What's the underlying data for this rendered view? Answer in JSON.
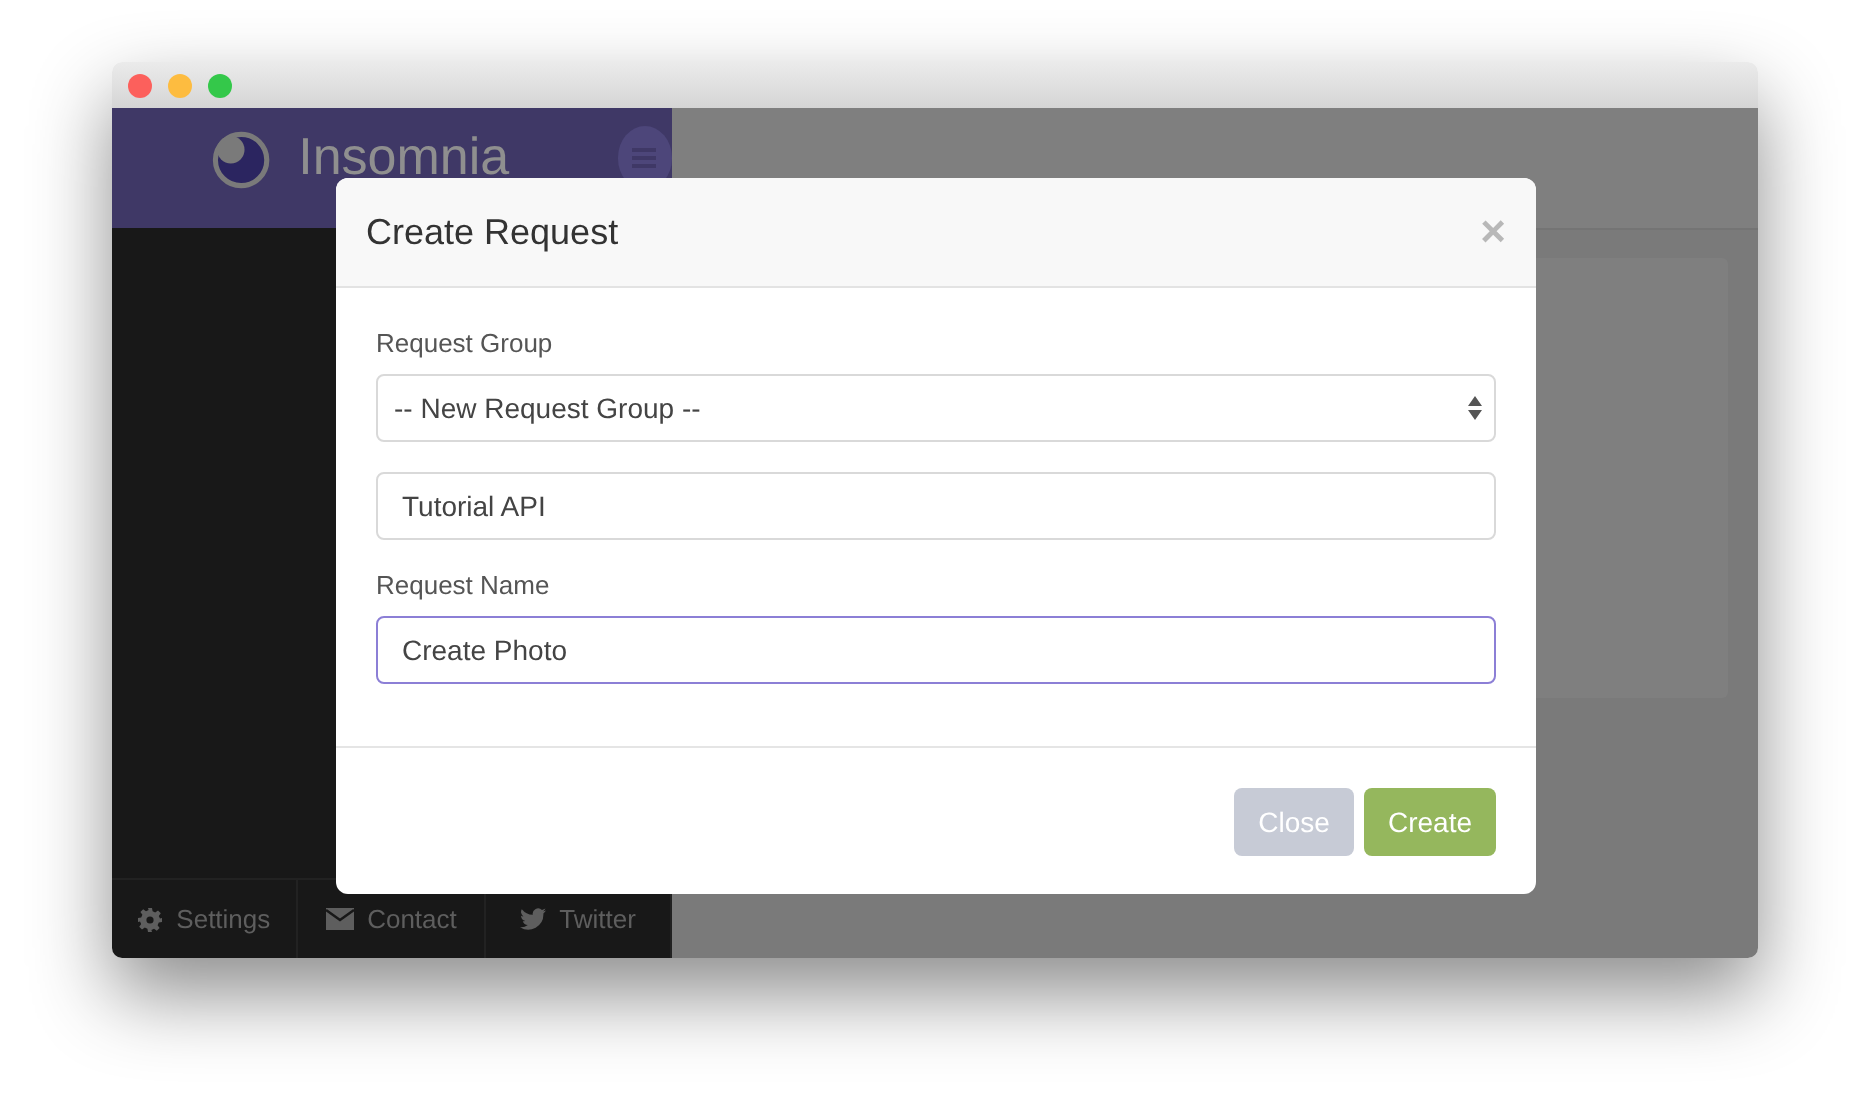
{
  "app": {
    "name": "Insomnia"
  },
  "sidebar_footer": [
    {
      "label": "Settings",
      "kind": "gear"
    },
    {
      "label": "Contact",
      "kind": "envelope"
    },
    {
      "label": "Twitter",
      "kind": "bird"
    }
  ],
  "dialog": {
    "title": "Create Request",
    "close": "×",
    "fields": [
      {
        "kind": "select",
        "label": "Request Group",
        "value": "-- New Request Group --",
        "focused": false
      },
      {
        "kind": "text",
        "value": "Tutorial API",
        "focused": false
      },
      {
        "kind": "text",
        "label": "Request Name",
        "value": "Create Photo",
        "focused": true
      }
    ],
    "buttons": [
      {
        "label": "Close",
        "kind": "secondary"
      },
      {
        "label": "Create",
        "kind": "primary"
      }
    ]
  }
}
